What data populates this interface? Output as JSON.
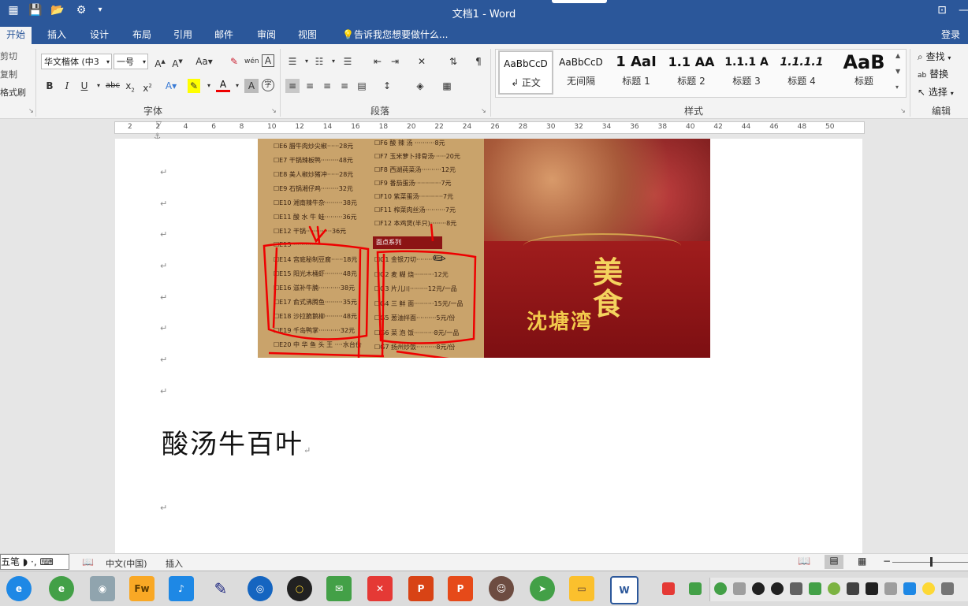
{
  "window": {
    "title": "文档1 - Word"
  },
  "tabs": [
    "开始",
    "插入",
    "设计",
    "布局",
    "引用",
    "邮件",
    "审阅",
    "视图"
  ],
  "tell_me": "告诉我您想要做什么...",
  "login": "登录",
  "clipboard": {
    "cut": "剪切",
    "copy": "复制",
    "format_painter": "格式刷"
  },
  "font": {
    "name": "华文楷体 (中3",
    "size": "一号",
    "group_label": "字体"
  },
  "paragraph": {
    "group_label": "段落"
  },
  "styles": {
    "group_label": "样式",
    "items": [
      {
        "preview": "AaBbCcD",
        "name": "↲ 正文"
      },
      {
        "preview": "AaBbCcD",
        "name": "无间隔"
      },
      {
        "preview": "1 AaI",
        "name": "标题 1"
      },
      {
        "preview": "1.1 AA",
        "name": "标题 2"
      },
      {
        "preview": "1.1.1 A",
        "name": "标题 3"
      },
      {
        "preview": "1.1.1.1",
        "name": "标题 4"
      },
      {
        "preview": "AaB",
        "name": "标题"
      }
    ]
  },
  "editing": {
    "find": "查找",
    "replace": "替换",
    "select": "选择",
    "group_label": "编辑"
  },
  "ruler_ticks": [
    "2",
    "2",
    "4",
    "6",
    "8",
    "10",
    "12",
    "14",
    "16",
    "18",
    "20",
    "22",
    "24",
    "26",
    "28",
    "30",
    "32",
    "34",
    "36",
    "38",
    "40",
    "42",
    "44",
    "46",
    "48",
    "50"
  ],
  "menu": {
    "left_items": [
      "☐E6 腊牛肉炒尖椒······28元",
      "☐E7 干锅辣板鸭·········48元",
      "☐E8 美人椒炒猪冲······28元",
      "☐E9 石锅湘仔鸡·········32元",
      "☐E10 湘南辣牛杂·········38元",
      "☐E11 酸 水 牛 蛙·········36元",
      "☐E12 干锅·············36元",
      "☐E13 ·················",
      "☐E14 宫庭秘制豆腐······18元",
      "☐E15 阳光木桶虾·········48元",
      "☐E16 滋补牛腩···········38元",
      "☐E17 俞式沸腾鱼·········35元",
      "☐E18 沙拉脆鹅柳·········48元",
      "☐E19 千岛鸭掌···········32元",
      "☐E20 中 华 鱼 头 王 ····水台价"
    ],
    "right_items": [
      "☐F6 酸 辣 汤 ··········8元",
      "☐F7 玉米萝卜排骨汤······20元",
      "☐F8 西湖莼菜汤··········12元",
      "☐F9 番茄蛋汤·············7元",
      "☐F10 紫菜蛋汤············7元",
      "☐F11 榨菜肉丝汤··········7元",
      "☐F12 本鸡煲(半只)········8元"
    ],
    "noodle_title": "面点系列",
    "noodle_items": [
      "☐G1 金银刀切········",
      "☐G2 麦 糊 烧··········12元",
      "☐G3 片儿川·········12元/一品",
      "☐G4 三 鲜 面··········15元/一品",
      "☐G5 葱油拌面··········5元/份",
      "☐G6 菜 泡 饭··········8元/一品",
      "☐G7 扬州炒饭··········8元/份"
    ],
    "brand": "沈塘湾",
    "brand_large": "美食"
  },
  "document": {
    "heading": "酸汤牛百叶"
  },
  "status": {
    "language": "中文(中国)",
    "mode": "插入"
  },
  "ime": {
    "label": "五笔"
  },
  "taskbar_apps": [
    "ie",
    "360",
    "camera",
    "Fw",
    "music",
    "tools",
    "video",
    "obs",
    "wechat",
    "xmind",
    "ppt",
    "ppt2",
    "avatar",
    "send",
    "folder",
    "W"
  ]
}
